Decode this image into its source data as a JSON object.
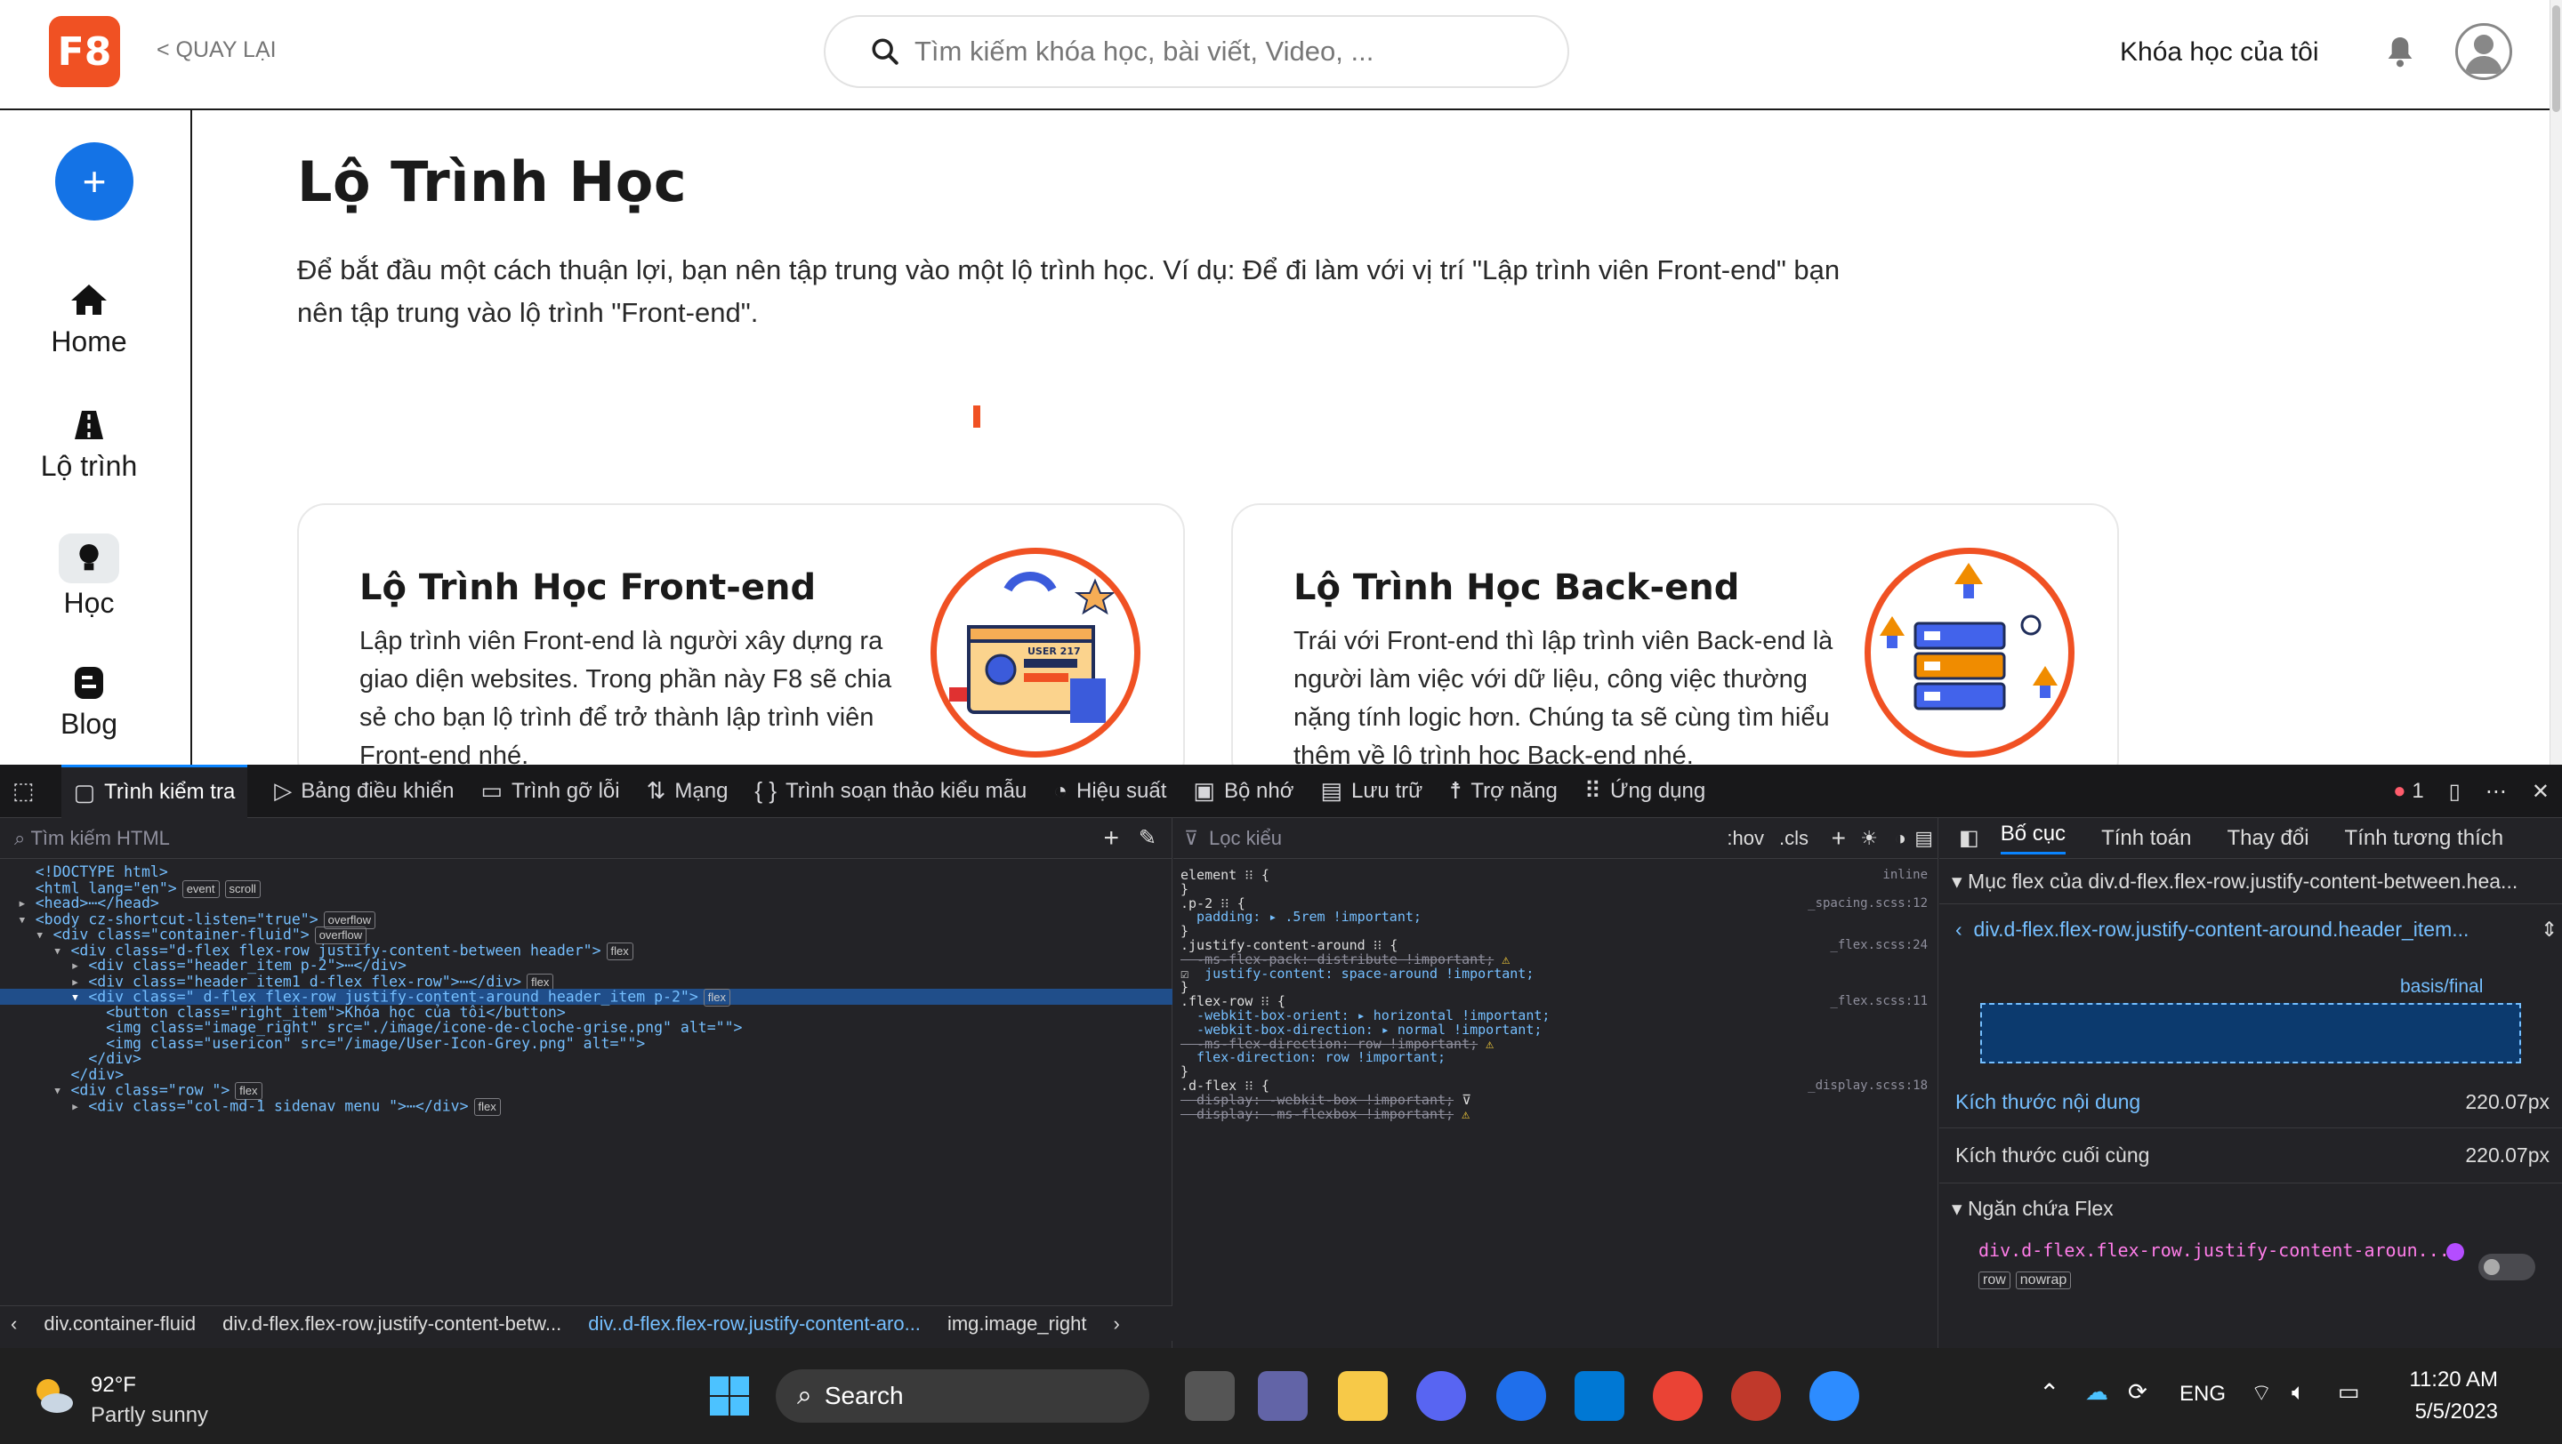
{
  "header": {
    "logo": "F8",
    "back": "< QUAY LẠI",
    "search_placeholder": "Tìm kiếm khóa học, bài viết, Video, ...",
    "my_courses": "Khóa học của tôi"
  },
  "sidebar": {
    "items": [
      {
        "label": "Home",
        "icon": "home-icon"
      },
      {
        "label": "Lộ trình",
        "icon": "road-icon"
      },
      {
        "label": "Học",
        "icon": "lightbulb-icon"
      },
      {
        "label": "Blog",
        "icon": "blog-icon"
      }
    ]
  },
  "main": {
    "title": "Lộ Trình Học",
    "intro": "Để bắt đầu một cách thuận lợi, bạn nên tập trung vào một lộ trình học. Ví dụ: Để đi làm với vị trí \"Lập trình viên Front-end\" bạn nên tập trung vào lộ trình \"Front-end\".",
    "cards": [
      {
        "title": "Lộ Trình Học Front-end",
        "desc": "Lập trình viên Front-end là người xây dựng ra giao diện websites. Trong phần này F8 sẽ chia sẻ cho bạn lộ trình để trở thành lập trình viên Front-end nhé.",
        "badge": "USER 217"
      },
      {
        "title": "Lộ Trình Học Back-end",
        "desc": "Trái với Front-end thì lập trình viên Back-end là người làm việc với dữ liệu, công việc thường nặng tính logic hơn. Chúng ta sẽ cùng tìm hiểu thêm về lộ trình học Back-end nhé."
      }
    ]
  },
  "devtools": {
    "tabs": [
      "Trình kiểm tra",
      "Bảng điều khiển",
      "Trình gỡ lỗi",
      "Mạng",
      "Trình soạn thảo kiểu mẫu",
      "Hiệu suất",
      "Bộ nhớ",
      "Lưu trữ",
      "Trợ năng",
      "Ứng dụng"
    ],
    "error_count": "1",
    "html_search": "Tìm kiếm HTML",
    "html_lines": [
      {
        "text": "<!DOCTYPE html>"
      },
      {
        "text": "<html lang=\"en\">",
        "badges": [
          "event",
          "scroll"
        ]
      },
      {
        "text": "<head>⋯</head>"
      },
      {
        "text": "<body cz-shortcut-listen=\"true\">",
        "badges": [
          "overflow"
        ]
      },
      {
        "text": "<div class=\"container-fluid\">",
        "badges": [
          "overflow"
        ]
      },
      {
        "text": "<div class=\"d-flex flex-row justify-content-between header\">",
        "badges": [
          "flex"
        ]
      },
      {
        "text": "<div class=\"header_item p-2\">⋯</div>"
      },
      {
        "text": "<div class=\"header_item1 d-flex flex-row\">⋯</div>",
        "badges": [
          "flex"
        ]
      },
      {
        "text": "<div class=\" d-flex flex-row justify-content-around header_item p-2\">",
        "badges": [
          "flex"
        ]
      },
      {
        "text": "<button class=\"right_item\">Khóa học của tôi</button>"
      },
      {
        "text": "<img class=\"image_right\" src=\"./image/icone-de-cloche-grise.png\" alt=\"\">"
      },
      {
        "text": "<img class=\"usericon\" src=\"/image/User-Icon-Grey.png\" alt=\"\">"
      },
      {
        "text": "</div>"
      },
      {
        "text": "</div>"
      },
      {
        "text": "<div class=\"row \">",
        "badges": [
          "flex"
        ]
      },
      {
        "text": "<div class=\"col-md-1 sidenav menu \">⋯</div>",
        "badges": [
          "flex"
        ]
      }
    ],
    "breadcrumbs": [
      "div.container-fluid",
      "div.d-flex.flex-row.justify-content-betw...",
      "div..d-flex.flex-row.justify-content-aro...",
      "img.image_right"
    ],
    "css_filter": "Lọc kiểu",
    "css_toolbar": [
      ":hov",
      ".cls"
    ],
    "css_rules": [
      {
        "line": "element ⁝⁝ {",
        "src": "inline"
      },
      {
        "line": "}"
      },
      {
        "line": ".p-2 ⁝⁝ {",
        "src": "_spacing.scss:12"
      },
      {
        "line": "padding: ▸ .5rem !important;",
        "prop": true
      },
      {
        "line": "}"
      },
      {
        "line": ".justify-content-around ⁝⁝ {",
        "src": "_flex.scss:24"
      },
      {
        "line": "-ms-flex-pack: distribute !important;",
        "strike": true,
        "warn": true
      },
      {
        "line": "justify-content: space-around !important;",
        "prop": true,
        "check": true
      },
      {
        "line": "}"
      },
      {
        "line": ".flex-row ⁝⁝ {",
        "src": "_flex.scss:11"
      },
      {
        "line": "-webkit-box-orient: ▸ horizontal !important;",
        "prop": true
      },
      {
        "line": "-webkit-box-direction: ▸ normal !important;",
        "prop": true
      },
      {
        "line": "-ms-flex-direction: row !important;",
        "strike": true,
        "warn": true
      },
      {
        "line": "flex-direction: row !important;",
        "prop": true
      },
      {
        "line": "}"
      },
      {
        "line": ".d-flex ⁝⁝ {",
        "src": "_display.scss:18"
      },
      {
        "line": "display: -webkit-box !important;",
        "strike": true,
        "filter": true
      },
      {
        "line": "display: -ms-flexbox !important;",
        "strike": true,
        "warn": true
      }
    ],
    "layout_tabs": [
      "Bố cục",
      "Tính toán",
      "Thay đổi",
      "Tính tương thích"
    ],
    "flex_item_header": "Mục flex của div.d-flex.flex-row.justify-content-between.hea...",
    "flex_item_selector": "div.d-flex.flex-row.justify-content-around.header_item...",
    "basis_label": "basis/final",
    "content_size_label": "Kích thước nội dung",
    "content_size_value": "220.07px",
    "final_size_label": "Kích thước cuối cùng",
    "final_size_value": "220.07px",
    "flex_container_header": "Ngăn chứa Flex",
    "flex_container_selector": "div.d-flex.flex-row.justify-content-aroun...",
    "flex_badges": [
      "row",
      "nowrap"
    ]
  },
  "taskbar": {
    "temp": "92°F",
    "weather": "Partly sunny",
    "search": "Search",
    "lang": "ENG",
    "time": "11:20 AM",
    "date": "5/5/2023"
  }
}
